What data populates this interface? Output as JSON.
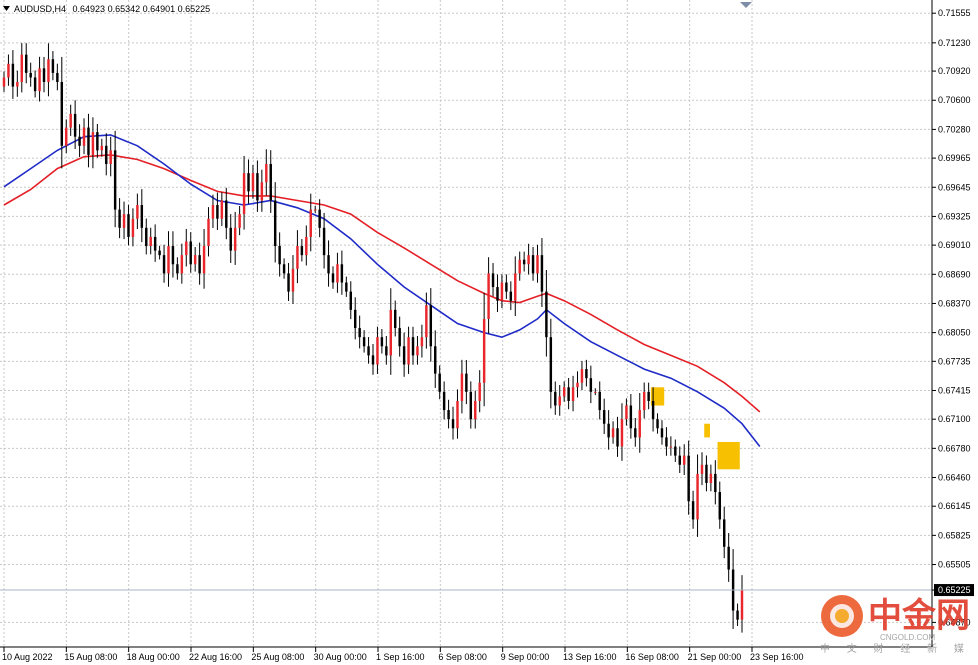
{
  "header": {
    "symbol": "AUDUSD,H4",
    "ohlc": "0.64923 0.65342 0.64901 0.65225"
  },
  "colors": {
    "bull_candle": "#e8262b",
    "bear_candle": "#000000",
    "ma_fast": "#1f2bc7",
    "ma_slow": "#e41f26",
    "grid": "#c8c8c8",
    "highlight": "#f7c000",
    "bid_line": "#a9b4c6"
  },
  "chart_data": {
    "type": "candlestick",
    "symbol": "AUDUSD",
    "timeframe": "H4",
    "ylim": [
      0.646,
      0.717
    ],
    "y_ticks": [
      "0.71555",
      "0.71230",
      "0.70920",
      "0.70600",
      "0.70280",
      "0.69965",
      "0.69645",
      "0.69325",
      "0.69010",
      "0.68690",
      "0.68370",
      "0.68050",
      "0.67735",
      "0.67415",
      "0.67100",
      "0.66780",
      "0.66460",
      "0.66145",
      "0.65825",
      "0.65505",
      "0.65225",
      "0.64870"
    ],
    "x_ticks": [
      "10 Aug 2022",
      "15 Aug 08:00",
      "18 Aug 00:00",
      "22 Aug 16:00",
      "25 Aug 08:00",
      "30 Aug 00:00",
      "1 Sep 16:00",
      "6 Sep 08:00",
      "9 Sep 00:00",
      "13 Sep 16:00",
      "16 Sep 08:00",
      "21 Sep 00:00",
      "23 Sep 16:00"
    ],
    "current_price": "0.65225",
    "closes": [
      0.7085,
      0.71,
      0.7075,
      0.708,
      0.711,
      0.709,
      0.7085,
      0.707,
      0.7095,
      0.708,
      0.7105,
      0.709,
      0.708,
      0.701,
      0.703,
      0.7045,
      0.702,
      0.701,
      0.703,
      0.7,
      0.7025,
      0.7005,
      0.701,
      0.699,
      0.7005,
      0.694,
      0.692,
      0.6935,
      0.691,
      0.693,
      0.6945,
      0.692,
      0.69,
      0.691,
      0.6895,
      0.689,
      0.687,
      0.69,
      0.688,
      0.687,
      0.689,
      0.6905,
      0.688,
      0.689,
      0.687,
      0.69,
      0.693,
      0.6945,
      0.693,
      0.695,
      0.692,
      0.6895,
      0.692,
      0.6935,
      0.698,
      0.696,
      0.698,
      0.695,
      0.697,
      0.699,
      0.695,
      0.69,
      0.688,
      0.687,
      0.685,
      0.6875,
      0.69,
      0.689,
      0.691,
      0.694,
      0.694,
      0.692,
      0.689,
      0.687,
      0.686,
      0.688,
      0.686,
      0.685,
      0.683,
      0.681,
      0.68,
      0.679,
      0.678,
      0.677,
      0.68,
      0.679,
      0.678,
      0.683,
      0.681,
      0.679,
      0.677,
      0.68,
      0.678,
      0.679,
      0.68,
      0.6835,
      0.679,
      0.676,
      0.674,
      0.672,
      0.671,
      0.67,
      0.673,
      0.676,
      0.674,
      0.671,
      0.673,
      0.675,
      0.682,
      0.687,
      0.6855,
      0.684,
      0.686,
      0.685,
      0.684,
      0.687,
      0.6885,
      0.688,
      0.689,
      0.687,
      0.689,
      0.685,
      0.68,
      0.674,
      0.6725,
      0.6735,
      0.6745,
      0.673,
      0.6745,
      0.675,
      0.6765,
      0.6755,
      0.674,
      0.674,
      0.672,
      0.6705,
      0.669,
      0.67,
      0.668,
      0.671,
      0.6725,
      0.67,
      0.669,
      0.672,
      0.674,
      0.673,
      0.671,
      0.67,
      0.669,
      0.668,
      0.668,
      0.667,
      0.666,
      0.667,
      0.662,
      0.66,
      0.665,
      0.666,
      0.664,
      0.665,
      0.663,
      0.66,
      0.657,
      0.6545,
      0.65,
      0.649,
      0.6523
    ],
    "ma_fast_points": [
      [
        0,
        0.6965
      ],
      [
        6,
        0.6985
      ],
      [
        12,
        0.7005
      ],
      [
        18,
        0.702
      ],
      [
        24,
        0.7022
      ],
      [
        30,
        0.701
      ],
      [
        36,
        0.699
      ],
      [
        42,
        0.6968
      ],
      [
        48,
        0.695
      ],
      [
        54,
        0.6945
      ],
      [
        60,
        0.695
      ],
      [
        66,
        0.6942
      ],
      [
        72,
        0.693
      ],
      [
        78,
        0.6908
      ],
      [
        84,
        0.688
      ],
      [
        90,
        0.6855
      ],
      [
        96,
        0.6835
      ],
      [
        102,
        0.6815
      ],
      [
        108,
        0.6805
      ],
      [
        112,
        0.68
      ],
      [
        116,
        0.6808
      ],
      [
        120,
        0.682
      ],
      [
        122,
        0.683
      ],
      [
        126,
        0.6815
      ],
      [
        132,
        0.6795
      ],
      [
        138,
        0.678
      ],
      [
        144,
        0.6765
      ],
      [
        150,
        0.6755
      ],
      [
        156,
        0.674
      ],
      [
        162,
        0.6722
      ],
      [
        166,
        0.6705
      ],
      [
        170,
        0.668
      ]
    ],
    "ma_slow_points": [
      [
        0,
        0.6945
      ],
      [
        6,
        0.6962
      ],
      [
        12,
        0.6985
      ],
      [
        18,
        0.6998
      ],
      [
        24,
        0.7
      ],
      [
        30,
        0.6995
      ],
      [
        36,
        0.6985
      ],
      [
        42,
        0.6972
      ],
      [
        48,
        0.696
      ],
      [
        54,
        0.6955
      ],
      [
        60,
        0.6955
      ],
      [
        66,
        0.695
      ],
      [
        72,
        0.6945
      ],
      [
        78,
        0.6935
      ],
      [
        84,
        0.6915
      ],
      [
        90,
        0.6898
      ],
      [
        96,
        0.688
      ],
      [
        102,
        0.6862
      ],
      [
        108,
        0.6848
      ],
      [
        112,
        0.684
      ],
      [
        116,
        0.6838
      ],
      [
        120,
        0.6845
      ],
      [
        122,
        0.6848
      ],
      [
        126,
        0.684
      ],
      [
        132,
        0.6825
      ],
      [
        138,
        0.6808
      ],
      [
        144,
        0.6792
      ],
      [
        150,
        0.678
      ],
      [
        156,
        0.6768
      ],
      [
        162,
        0.675
      ],
      [
        166,
        0.6735
      ],
      [
        170,
        0.6718
      ]
    ],
    "highlight_boxes": [
      {
        "start": 146,
        "end": 148,
        "top": 0.6745,
        "bottom": 0.6725
      },
      {
        "start": 158,
        "end": 158.3,
        "top": 0.6705,
        "bottom": 0.669
      },
      {
        "start": 161,
        "end": 165,
        "top": 0.6685,
        "bottom": 0.6655
      }
    ]
  },
  "watermark": {
    "logo_char": "中金网",
    "domain": "CNGOLD.COM",
    "subtitle": "中 文 财 经 新 媒 体"
  }
}
